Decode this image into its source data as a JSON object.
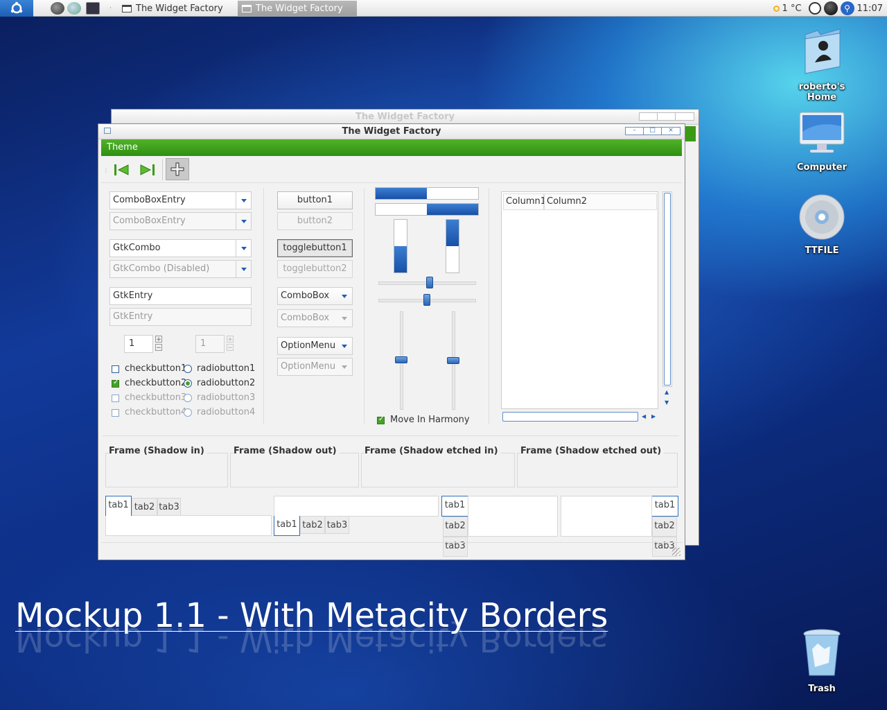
{
  "panel": {
    "tasks": [
      {
        "label": "The Widget Factory",
        "active": false
      },
      {
        "label": "The Widget Factory",
        "active": true
      }
    ],
    "temperature": "1 °C",
    "clock": "11:07"
  },
  "desktop": {
    "icons": [
      {
        "label": "roberto's Home",
        "icon": "home-folder-icon"
      },
      {
        "label": "Computer",
        "icon": "computer-icon"
      },
      {
        "label": "TTFILE",
        "icon": "disc-icon"
      },
      {
        "label": "Trash",
        "icon": "trash-icon"
      }
    ],
    "caption": "Mockup 1.1 - With Metacity Borders"
  },
  "back_window": {
    "title": "The Widget Factory"
  },
  "window": {
    "title": "The Widget Factory",
    "menu": "Theme",
    "left": {
      "combo_entry": "ComboBoxEntry",
      "combo_entry_dis": "ComboBoxEntry",
      "gtk_combo": "GtkCombo",
      "gtk_combo_dis": "GtkCombo (Disabled)",
      "entry": "GtkEntry",
      "entry_dis": "GtkEntry",
      "spin1": "1",
      "spin2": "1",
      "checks": [
        {
          "label": "checkbutton1",
          "checked": false,
          "disabled": false
        },
        {
          "label": "checkbutton2",
          "checked": true,
          "disabled": false
        },
        {
          "label": "checkbutton3",
          "checked": false,
          "disabled": true
        },
        {
          "label": "checkbutton4",
          "checked": false,
          "disabled": true
        }
      ],
      "radios": [
        {
          "label": "radiobutton1",
          "checked": false,
          "disabled": false
        },
        {
          "label": "radiobutton2",
          "checked": true,
          "disabled": false
        },
        {
          "label": "radiobutton3",
          "checked": false,
          "disabled": true
        },
        {
          "label": "radiobutton4",
          "checked": false,
          "disabled": true
        }
      ]
    },
    "middle": {
      "button1": "button1",
      "button2": "button2",
      "toggle1": "togglebutton1",
      "toggle2": "togglebutton2",
      "combobox": "ComboBox",
      "combobox_dis": "ComboBox",
      "option": "OptionMenu",
      "option_dis": "OptionMenu"
    },
    "progress": {
      "h1": 0.5,
      "h2": 0.5,
      "v1": 0.5,
      "v2": 0.5
    },
    "harmony": "Move In Harmony",
    "tree": {
      "columns": [
        "Column1",
        "Column2"
      ]
    },
    "frames": [
      "Frame (Shadow in)",
      "Frame (Shadow out)",
      "Frame (Shadow etched in)",
      "Frame (Shadow etched out)"
    ],
    "tabs": [
      "tab1",
      "tab2",
      "tab3"
    ]
  }
}
